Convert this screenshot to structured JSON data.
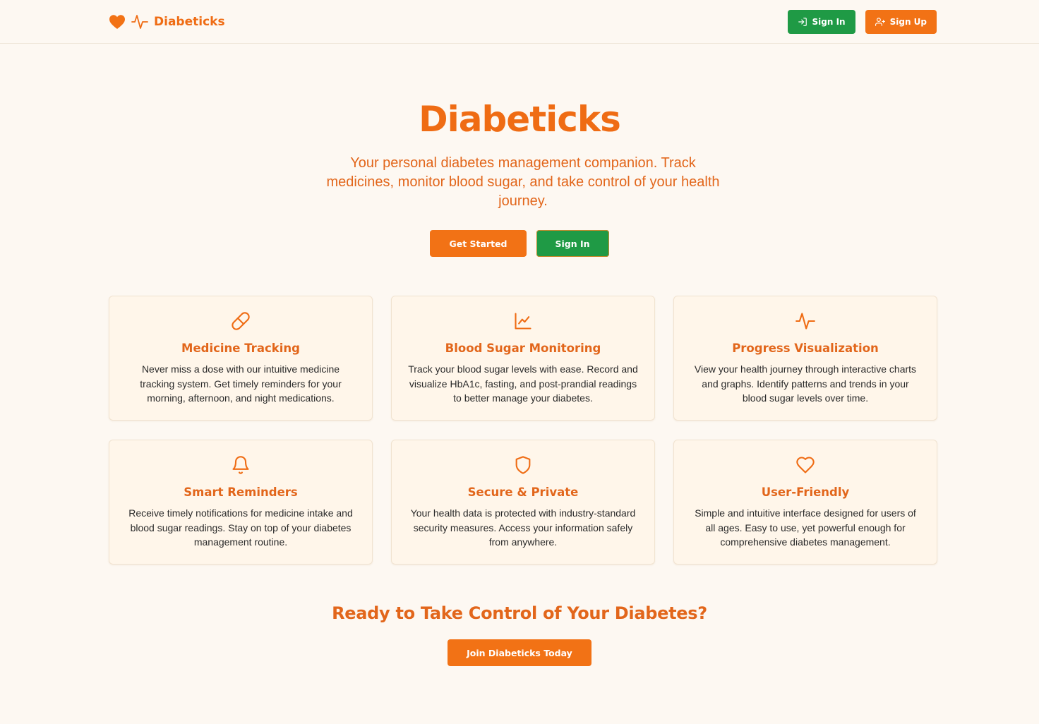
{
  "header": {
    "brand": "Diabeticks",
    "sign_in": "Sign In",
    "sign_up": "Sign Up"
  },
  "hero": {
    "title": "Diabeticks",
    "subtitle": "Your personal diabetes management companion. Track medicines, monitor blood sugar, and take control of your health journey.",
    "get_started": "Get Started",
    "sign_in": "Sign In"
  },
  "features": [
    {
      "icon": "pill-icon",
      "title": "Medicine Tracking",
      "desc": "Never miss a dose with our intuitive medicine tracking system. Get timely reminders for your morning, afternoon, and night medications."
    },
    {
      "icon": "line-chart-icon",
      "title": "Blood Sugar Monitoring",
      "desc": "Track your blood sugar levels with ease. Record and visualize HbA1c, fasting, and post-prandial readings to better manage your diabetes."
    },
    {
      "icon": "activity-icon",
      "title": "Progress Visualization",
      "desc": "View your health journey through interactive charts and graphs. Identify patterns and trends in your blood sugar levels over time."
    },
    {
      "icon": "bell-icon",
      "title": "Smart Reminders",
      "desc": "Receive timely notifications for medicine intake and blood sugar readings. Stay on top of your diabetes management routine."
    },
    {
      "icon": "shield-icon",
      "title": "Secure & Private",
      "desc": "Your health data is protected with industry-standard security measures. Access your information safely from anywhere."
    },
    {
      "icon": "heart-outline-icon",
      "title": "User-Friendly",
      "desc": "Simple and intuitive interface designed for users of all ages. Easy to use, yet powerful enough for comprehensive diabetes management."
    }
  ],
  "cta": {
    "title": "Ready to Take Control of Your Diabetes?",
    "button": "Join Diabeticks Today"
  },
  "colors": {
    "background": "#fdf8f2",
    "accent_orange": "#ef6c14",
    "accent_green": "#1f9a45",
    "card_bg": "#fff6ea"
  }
}
